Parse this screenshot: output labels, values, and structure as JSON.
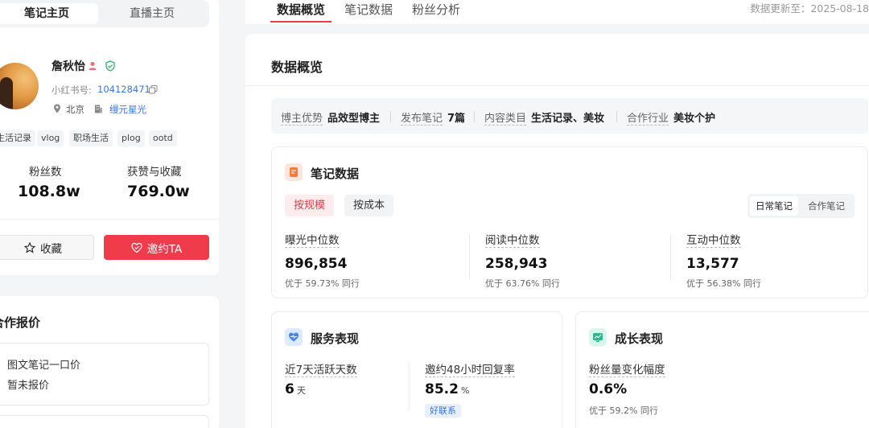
{
  "left": {
    "segments": [
      "笔记主页",
      "直播主页"
    ],
    "profile": {
      "name": "詹秋怡",
      "xhs_label": "小红书号:",
      "xhs_id": "104128471",
      "location": "北京",
      "org": "缦元星光"
    },
    "tags": [
      "生活记录",
      "vlog",
      "职场生活",
      "plog",
      "ootd"
    ],
    "stats": [
      {
        "label": "粉丝数",
        "value": "108.8w"
      },
      {
        "label": "获赞与收藏",
        "value": "769.0w"
      }
    ],
    "buttons": {
      "favorite": "收藏",
      "invite": "邀约TA"
    },
    "pricing": {
      "title": "合作报价",
      "item": "图文笔记一口价",
      "value": "暂未报价"
    }
  },
  "topbar": {
    "tabs": [
      "数据概览",
      "笔记数据",
      "粉丝分析"
    ],
    "update": "数据更新至：2025-08-18"
  },
  "main": {
    "title": "数据概览",
    "info": [
      {
        "key": "博主优势",
        "value": "品效型博主"
      },
      {
        "key": "发布笔记",
        "value": "7篇"
      },
      {
        "key": "内容类目",
        "value": "生活记录、美妆"
      },
      {
        "key": "合作行业",
        "value": "美妆个护"
      }
    ],
    "notes": {
      "title": "笔记数据",
      "pills": [
        "按规模",
        "按成本"
      ],
      "toggle": [
        "日常笔记",
        "合作笔记"
      ],
      "metrics": [
        {
          "label": "曝光中位数",
          "value": "896,854",
          "sub": "优于 59.73% 同行"
        },
        {
          "label": "阅读中位数",
          "value": "258,943",
          "sub": "优于 63.76% 同行"
        },
        {
          "label": "互动中位数",
          "value": "13,577",
          "sub": "优于 56.38% 同行"
        }
      ]
    },
    "service": {
      "title": "服务表现",
      "active_label": "近7天活跃天数",
      "active_value": "6",
      "active_unit": "天",
      "reply_label": "邀约48小时回复率",
      "reply_value": "85.2",
      "reply_unit": "%",
      "reply_tag": "好联系"
    },
    "growth": {
      "title": "成长表现",
      "label": "粉丝量变化幅度",
      "value": "0.6%",
      "sub": "优于 59.2% 同行"
    }
  },
  "colors": {
    "accent": "#ef3b4a",
    "link": "#3b73e8"
  }
}
